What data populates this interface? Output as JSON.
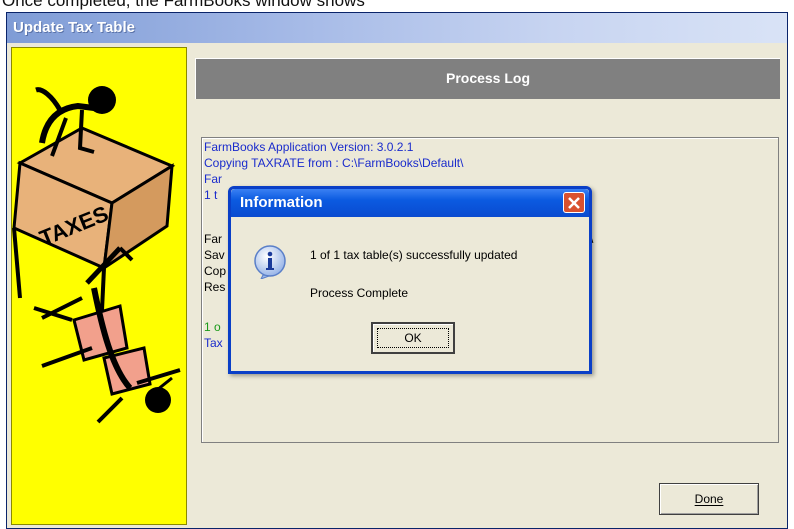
{
  "window": {
    "title": "Update Tax Table"
  },
  "artwork": {
    "sign_text": "TAXES"
  },
  "header": {
    "title": "Process Log"
  },
  "log": {
    "line1": "FarmBooks Application Version: 3.0.2.1",
    "line2": "Copying TAXRATE from : C:\\FarmBooks\\Default\\",
    "frag_far1": "Far",
    "frag_1t": "1 t",
    "frag_far2": "Far",
    "frag_sav": "Sav",
    "frag_cop": "Cop",
    "frag_res": "Res",
    "frag_m": "m\\",
    "frag_1o": "1 o",
    "frag_tax": "Tax"
  },
  "dialog": {
    "title": "Information",
    "message": "1 of 1 tax table(s) successfully updated",
    "status": "Process Complete",
    "ok_label": "OK"
  },
  "buttons": {
    "done_label": "Done"
  },
  "colors": {
    "log_blue": "#1a2bcc",
    "log_green": "#1a9a1a",
    "sidepanel_yellow": "#ffff00",
    "dialog_blue": "#0a3fc7"
  }
}
